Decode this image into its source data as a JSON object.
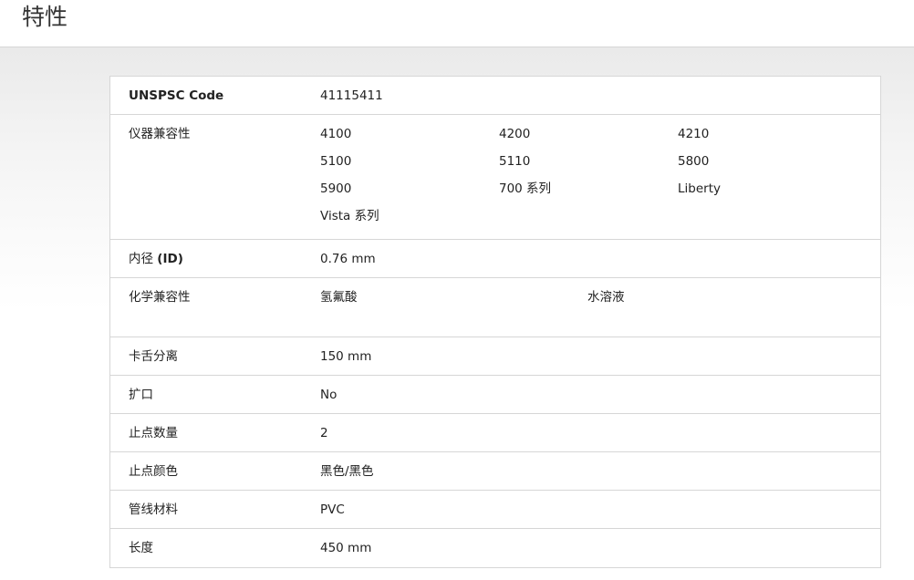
{
  "page_title": "特性",
  "rows": {
    "unspsc": {
      "label": "UNSPSC Code",
      "value": "41115411"
    },
    "instrument": {
      "label": "仪器兼容性",
      "values": [
        "4100",
        "4200",
        "4210",
        "5100",
        "5110",
        "5800",
        "5900",
        "700 系列",
        "Liberty",
        "Vista 系列"
      ]
    },
    "inner_diameter": {
      "label_prefix": "内径 ",
      "label_suffix": "(ID)",
      "value": "0.76 mm"
    },
    "chemical": {
      "label": "化学兼容性",
      "values": [
        "氢氟酸",
        "水溶液"
      ]
    },
    "tab_sep": {
      "label": "卡舌分离",
      "value": "150 mm"
    },
    "flared": {
      "label": "扩口",
      "value": "No"
    },
    "stop_count": {
      "label": "止点数量",
      "value": "2"
    },
    "stop_color": {
      "label": "止点颜色",
      "value": "黑色/黑色"
    },
    "tubing_material": {
      "label": "管线材料",
      "value": "PVC"
    },
    "length": {
      "label": "长度",
      "value": "450 mm"
    }
  }
}
